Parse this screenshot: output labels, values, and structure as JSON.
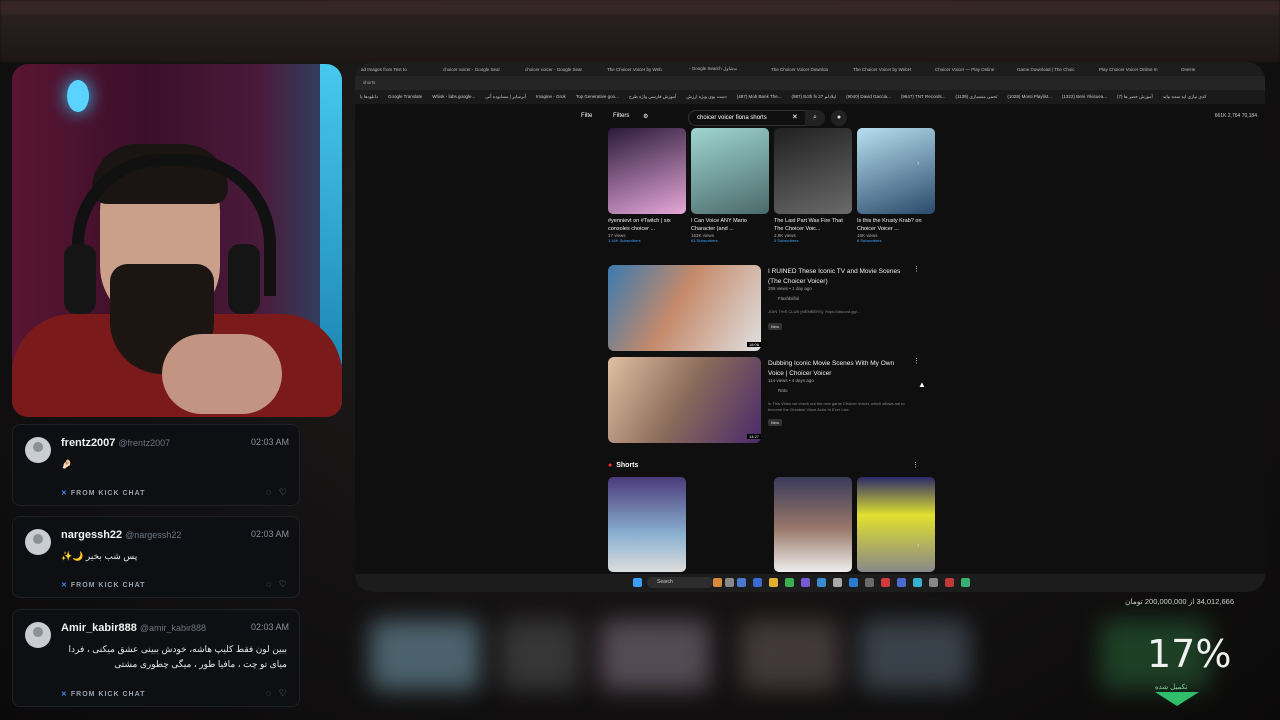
{
  "browser": {
    "tabs": [
      "ad Images from Text to",
      "choicer voicer - Google Sear",
      "choicer voicer - Google Sear",
      "The Choicer Voicer by Web",
      "- Google Search ندشاول",
      "The Choicer Voicer Downloa",
      "The Choicer Voicer by WebH",
      "Choicer Voicer — Play Online",
      "Game Download | The Choic",
      "Play Choicer Voicer Online In",
      "OneHe"
    ],
    "address": "shorts",
    "bookmarks": [
      "دانلودها یا",
      "Google Translate",
      "Whisk - labs.google...",
      "آبرسایر | مسابوده آنی",
      "Imagine - Grok",
      "Top Generative goo...",
      "آموزش فارسی واژه طرح",
      "دست بوی ویژه ارزش",
      "(487) Mob Bank The...",
      "(987) Ecth fx 27 ایلادلم",
      "(9040) David Gaccia...",
      "(9647) TNT Records...",
      "تحمی منسبازی (1139)",
      "(1028) Monti Playlist...",
      "(1322) Beni Yikisuea...",
      "آموزش حصر ها (7)",
      "کدی نیازی اید سده بیاید"
    ],
    "filters": {
      "btn1": "Filte",
      "btn2": "Filters"
    },
    "search_value": "choicer voicer fiona shorts",
    "stats": "661K  2,764  70,184",
    "top_cards": [
      {
        "title": "#yennievt on #Twitch | six consoles choicer ...",
        "views": "17 views",
        "subs": "1.16K Subscribers",
        "c1": "#2a1a3a",
        "c2": "#e6a7d8"
      },
      {
        "title": "I Can Voice ANY Mario Character (and ...",
        "views": "163K views",
        "subs": "63 Subscribers",
        "c1": "#9fd6d0",
        "c2": "#4a6a6a"
      },
      {
        "title": "The Last Part Was Fire That The Choicer Voic...",
        "views": "2.8K views",
        "subs": "5 Subscribers",
        "c1": "#202020",
        "c2": "#6a6a6a"
      },
      {
        "title": "Is this the Krusty Krab? on Choicer Voicer ...",
        "views": "16K views",
        "subs": "8 Subscribers",
        "c1": "#b7e0f0",
        "c2": "#2a4a6a"
      }
    ],
    "videos": [
      {
        "title": "I RUINED These Iconic TV and Movie Scenes (The Choicer Voicer)",
        "meta": "255 views • 1 day ago",
        "channel": "Flashbiifiol",
        "desc": "JOIN THIS CLUB (MEMBERS): https://discord.gg/...",
        "badge": "New",
        "duration": "18:06"
      },
      {
        "title": "Dubbing Iconic Movie Scenes With My Own Voice | Choicer Voicer",
        "meta": "114 views • 4 days ago",
        "channel": "Rato",
        "desc": "In This Video we check out the new game Choicer Voicer, which allows me to become the Greatest Voice Actor to Ever Live.",
        "badge": "New",
        "duration": "14:27"
      }
    ],
    "shorts_title": "Shorts",
    "taskbar_search": "Search"
  },
  "chat": [
    {
      "name": "frentz2007",
      "handle": "@frentz2007",
      "time": "02:03 AM",
      "message": "🤌🏻",
      "source": "FROM KICK CHAT"
    },
    {
      "name": "nargessh22",
      "handle": "@nargessh22",
      "time": "02:03 AM",
      "message": "✨🌙 پس شب بخیر",
      "source": "FROM KICK CHAT"
    },
    {
      "name": "Amir_kabir888",
      "handle": "@amir_kabir888",
      "time": "02:03 AM",
      "message": "ببین لون فقط کلیپ هاشه، خودش ببینی عشق میکنی ، فردا میای تو چت ، مافیا طور ، میگی چطوری مشتی",
      "source": "FROM KICK CHAT"
    }
  ],
  "goal": {
    "text": "34,012,666 از 200,000,000 تومان",
    "percent": "17%",
    "percent_value": 0.17,
    "label": "تکمیل شده"
  },
  "colors": {
    "accent_blue": "#2e8dff",
    "goal_green": "#2fbf6a",
    "shorts_red": "#ff2a2a"
  }
}
